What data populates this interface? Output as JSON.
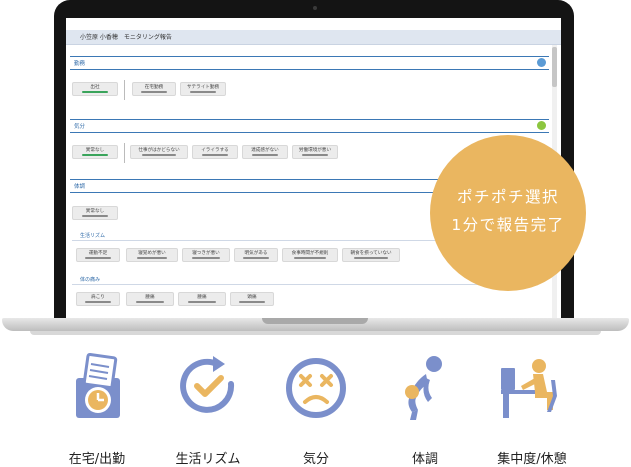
{
  "screen": {
    "title": "小笠原 小香穂　モニタリング報告",
    "sections": [
      {
        "label": "勤務",
        "buttons": [
          "出社",
          "在宅勤務",
          "サテライト勤務"
        ]
      },
      {
        "label": "気分",
        "buttons": [
          "異常なし",
          "仕事がはかどらない",
          "イライラする",
          "達成感がない",
          "労働環境が悪い"
        ]
      },
      {
        "label": "体調",
        "buttons": [
          "異常なし"
        ]
      }
    ],
    "rhythm": {
      "label": "生活リズム",
      "buttons": [
        "運動不足",
        "寝覚めが悪い",
        "寝つきが悪い",
        "明気がある",
        "食事時間が不規則",
        "朝食を摂っていない"
      ]
    },
    "pain": {
      "label": "体の痛み",
      "buttons": [
        "肩こり",
        "腰痛",
        "腰痛",
        "頭痛"
      ]
    }
  },
  "badge": {
    "line1": "ポチポチ選択",
    "line2": "1分で報告完了"
  },
  "features": [
    {
      "label": "在宅/出勤",
      "icon": "clock-document-icon"
    },
    {
      "label": "生活リズム",
      "icon": "rhythm-clock-icon"
    },
    {
      "label": "気分",
      "icon": "dizzy-face-icon"
    },
    {
      "label": "体調",
      "icon": "back-pain-icon"
    },
    {
      "label": "集中度/休憩",
      "icon": "desk-worker-icon"
    }
  ],
  "colors": {
    "accent": "#2f6aa8",
    "badge": "#eab660",
    "icon_blue": "#7b8fcb",
    "icon_orange": "#eab660",
    "selected": "#3aa45b"
  }
}
